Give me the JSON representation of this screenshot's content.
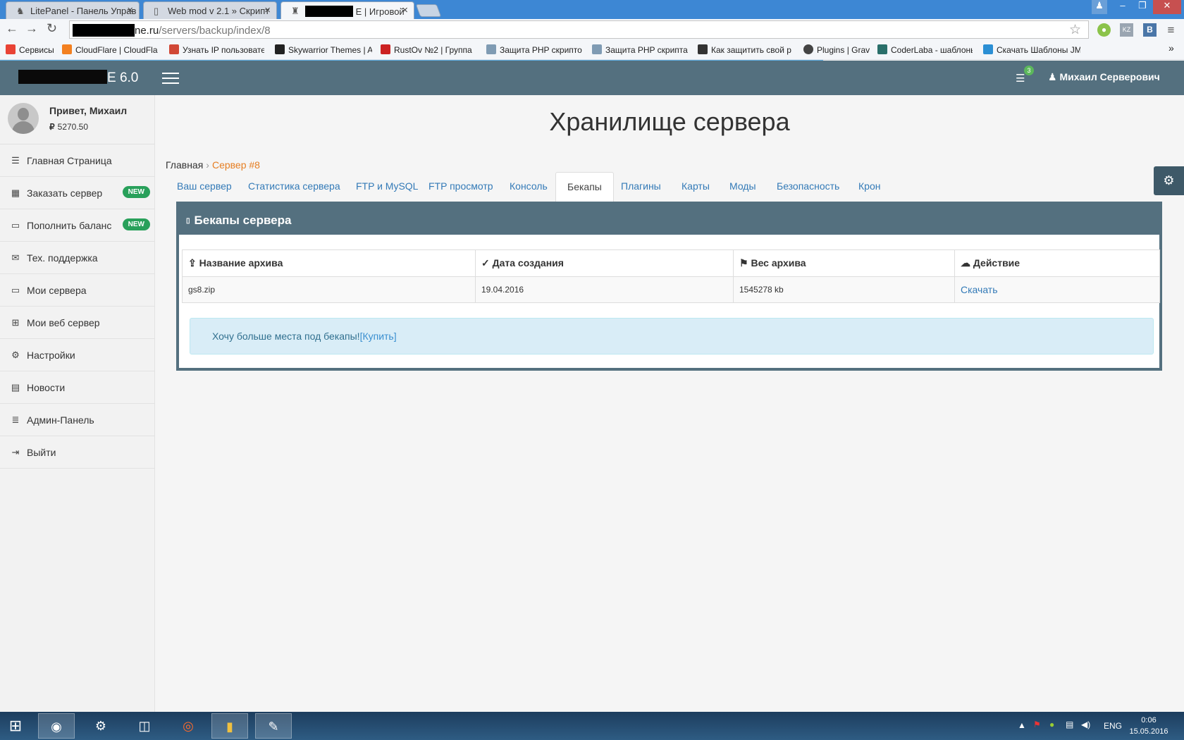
{
  "browser": {
    "tabs": [
      {
        "title": "LitePanel - Панель Управ",
        "icon": "litepanel-favicon"
      },
      {
        "title": "Web mod v 2.1 » Скрипт",
        "icon": "page-favicon"
      },
      {
        "title": "E | Игровой",
        "icon": "game-favicon"
      }
    ],
    "url_visible_host": "ne.ru",
    "url_path": "/servers/backup/index/8",
    "bookmarks": [
      {
        "label": "Сервисы",
        "color": "#e94335"
      },
      {
        "label": "CloudFlare | CloudFla",
        "color": "#f38020"
      },
      {
        "label": "Узнать IP пользовате",
        "color": "#d14836"
      },
      {
        "label": "Skywarrior Themes | A",
        "color": "#222222"
      },
      {
        "label": "RustOv №2 | Группа",
        "color": "#cc2222"
      },
      {
        "label": "Защита PHP скрипто",
        "color": "#7f9bb3"
      },
      {
        "label": "Защита PHP скрипта",
        "color": "#7f9bb3"
      },
      {
        "label": "Как защитить свой p",
        "color": "#333333"
      },
      {
        "label": "Plugins | Grav",
        "color": "#444444"
      },
      {
        "label": "CoderLaba - шаблоны",
        "color": "#2a6f6a"
      },
      {
        "label": "Скачать Шаблоны JM",
        "color": "#2b8fd4"
      }
    ],
    "extensions": [
      "KZ",
      "B"
    ]
  },
  "header": {
    "brand_suffix": "E 6.0",
    "notification_count": "3",
    "user_name": "Михаил Серверович"
  },
  "sidebar": {
    "greeting": "Привет, Михаил",
    "balance": "5270.50",
    "currency_symbol": "₽",
    "items": [
      {
        "label": "Главная Страница",
        "icon": "align-left-icon",
        "glyph": "☰",
        "badge": ""
      },
      {
        "label": "Заказать сервер",
        "icon": "grid-icon",
        "glyph": "▦",
        "badge": "NEW"
      },
      {
        "label": "Пополнить баланс",
        "icon": "money-icon",
        "glyph": "▭",
        "badge": "NEW"
      },
      {
        "label": "Тех. поддержка",
        "icon": "envelope-icon",
        "glyph": "✉",
        "badge": ""
      },
      {
        "label": "Мои сервера",
        "icon": "laptop-icon",
        "glyph": "▭",
        "badge": ""
      },
      {
        "label": "Мои веб сервер",
        "icon": "sitemap-icon",
        "glyph": "⊞",
        "badge": ""
      },
      {
        "label": "Настройки",
        "icon": "cogs-icon",
        "glyph": "⚙",
        "badge": ""
      },
      {
        "label": "Новости",
        "icon": "calendar-icon",
        "glyph": "▤",
        "badge": ""
      },
      {
        "label": "Админ-Панель",
        "icon": "list-icon",
        "glyph": "≣",
        "badge": ""
      },
      {
        "label": "Выйти",
        "icon": "sign-out-icon",
        "glyph": "⇥",
        "badge": ""
      }
    ]
  },
  "main": {
    "title": "Хранилище сервера",
    "breadcrumb": {
      "home": "Главная",
      "current": "Сервер #8"
    },
    "tabs": [
      {
        "label": "Ваш сервер"
      },
      {
        "label": "Статистика сервера"
      },
      {
        "label": "FTP и MySQL"
      },
      {
        "label": "FTP просмотр"
      },
      {
        "label": "Консоль"
      },
      {
        "label": "Бекапы"
      },
      {
        "label": "Плагины"
      },
      {
        "label": "Карты"
      },
      {
        "label": "Моды"
      },
      {
        "label": "Безопасность"
      },
      {
        "label": "Крон"
      }
    ],
    "active_tab": "Бекапы",
    "panel": {
      "title": "Бекапы сервера",
      "columns": [
        {
          "label": "Название архива",
          "icon": "share-icon",
          "glyph": "⇪"
        },
        {
          "label": "Дата создания",
          "icon": "check-circle-icon",
          "glyph": "✓"
        },
        {
          "label": "Вес архива",
          "icon": "flag-checkered-icon",
          "glyph": "⚑"
        },
        {
          "label": "Действие",
          "icon": "cloud-download-icon",
          "glyph": "☁"
        }
      ],
      "rows": [
        {
          "name": "gs8.zip",
          "date": "19.04.2016",
          "size": "1545278 kb",
          "action": "Скачать"
        }
      ],
      "alert_text": "Хочу больше места под бекапы!",
      "alert_link": "[Купить]"
    }
  },
  "taskbar": {
    "language": "ENG",
    "time": "0:06",
    "date": "15.05.2016"
  },
  "colors": {
    "header": "#54707f",
    "link": "#337ab7",
    "badge_new": "#28a05a",
    "breadcrumb_current": "#e67e22"
  }
}
